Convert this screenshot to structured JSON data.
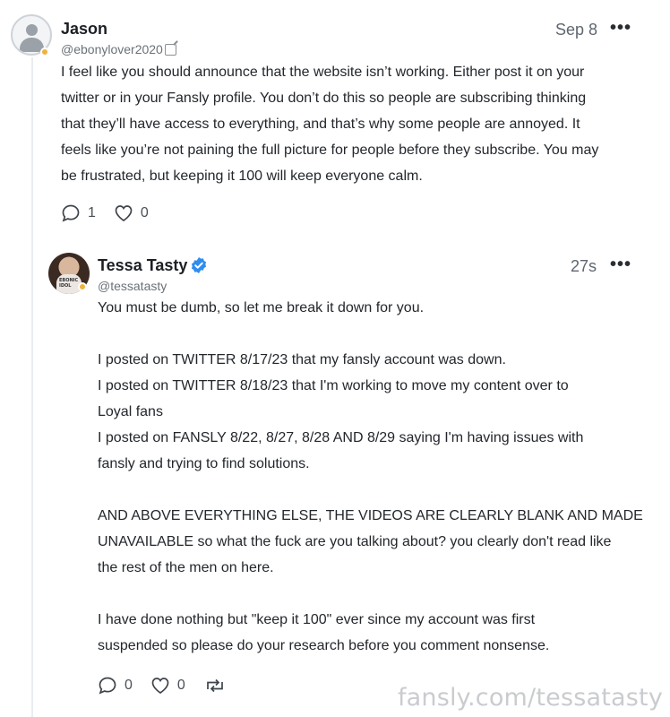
{
  "comments": [
    {
      "author": "Jason",
      "handle": "@ebonylover2020",
      "time": "Sep 8",
      "more": "•••",
      "text": "I feel like you should announce that the website isn’t working. Either post it on your\ntwitter or in your Fansly profile. You don’t do this so people are subscribing thinking\nthat they’ll have access to everything, and that’s why some people are annoyed. It\nfeels like you’re not paining the full picture for people before they subscribe. You may\nbe frustrated, but keeping it 100 will keep everyone calm.",
      "reply_count": "1",
      "like_count": "0"
    },
    {
      "author": "Tessa Tasty",
      "handle": "@tessatasty",
      "time": "27s",
      "more": "•••",
      "text": "You must be dumb, so let me break it down for you.\n\nI posted on TWITTER 8/17/23 that my fansly account was down.\nI posted on TWITTER 8/18/23 that I'm working to move my content over to\nLoyal fans\nI posted on FANSLY 8/22, 8/27, 8/28 AND 8/29 saying I'm having issues with\nfansly and trying to find solutions.\n\nAND ABOVE EVERYTHING ELSE, THE VIDEOS ARE CLEARLY BLANK AND MADE\nUNAVAILABLE so what the fuck are you talking about? you clearly don't read like\nthe rest of the men on here.\n\nI have done nothing but \"keep it 100\" ever since my account was first\nsuspended so please do your research before you comment nonsense.",
      "reply_count": "0",
      "like_count": "0",
      "avatar_shirt_text": "EBONIC\nIDOL"
    }
  ],
  "watermark": "fansly.com/tessatasty",
  "icons": {
    "avatar_placeholder": "user-silhouette-icon",
    "edit": "edit-icon",
    "verified": "verified-badge-icon",
    "reply": "speech-bubble-icon",
    "like": "heart-icon",
    "repost": "repost-icon"
  },
  "colors": {
    "status_dot": "#f0b23c",
    "verified": "#2f8cf0",
    "watermark": "#c9cccf"
  }
}
